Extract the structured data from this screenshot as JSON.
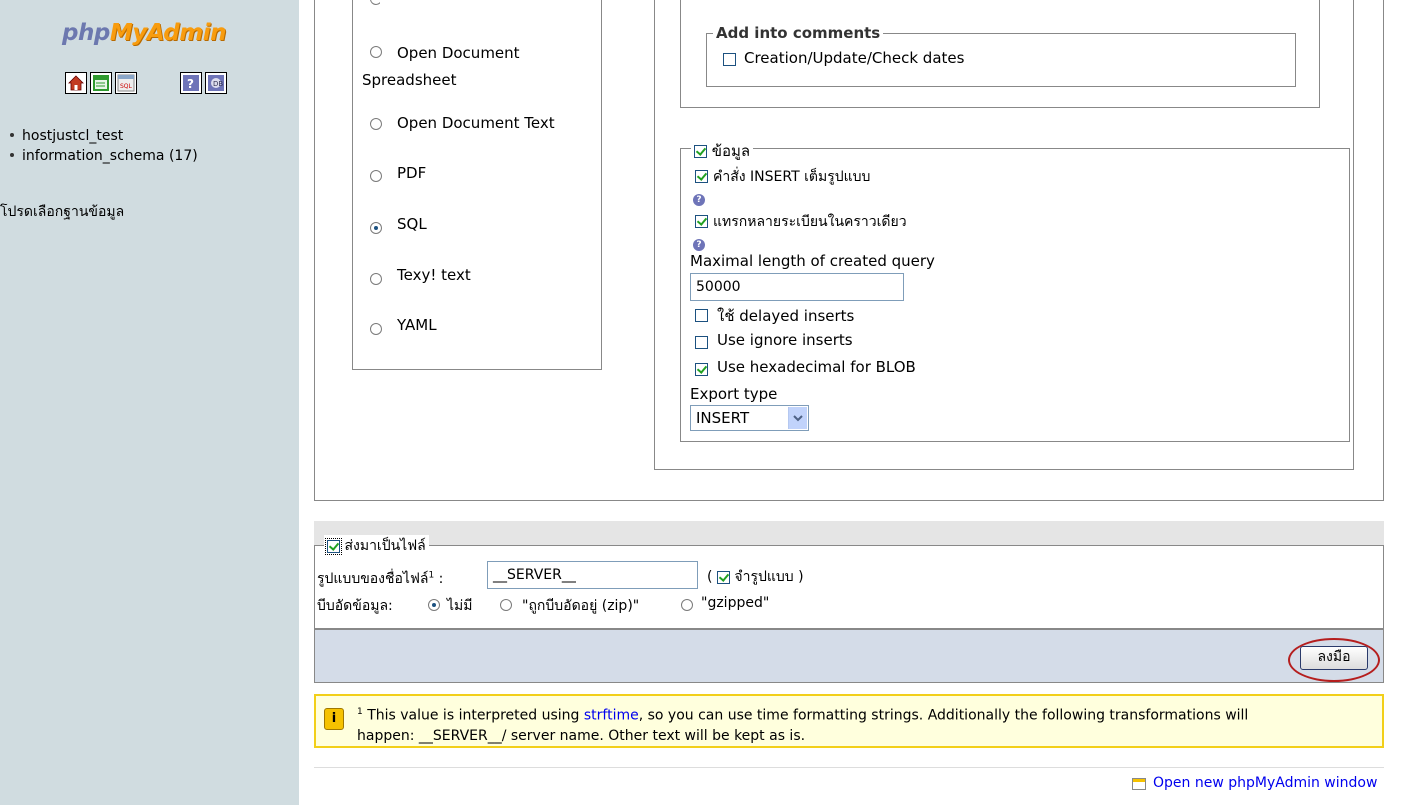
{
  "sidebar": {
    "logo_php": "php",
    "logo_myadmin": "MyAdmin",
    "nav_icons": [
      "home-icon",
      "query-window-icon",
      "sql-icon",
      "help-icon",
      "documentation-icon"
    ],
    "databases": [
      "hostjustcl_test",
      "information_schema (17)"
    ],
    "choose_db": "โปรดเลือกฐานข้อมูล"
  },
  "formats": [
    {
      "label": "Open Document Spreadsheet",
      "selected": false
    },
    {
      "label": "Open Document Text",
      "selected": false
    },
    {
      "label": "PDF",
      "selected": false
    },
    {
      "label": "SQL",
      "selected": true
    },
    {
      "label": "Texy! text",
      "selected": false
    },
    {
      "label": "YAML",
      "selected": false
    }
  ],
  "comments": {
    "legend": "Add into comments",
    "creation_dates_label": "Creation/Update/Check dates",
    "creation_dates_checked": false
  },
  "data_options": {
    "legend": "ข้อมูล",
    "complete_inserts": "คำสั่ง INSERT เต็มรูปแบบ",
    "extended_inserts": "แทรกหลายระเบียนในคราวเดียว",
    "max_query_label": "Maximal length of created query",
    "max_query_value": "50000",
    "delayed_inserts": "ใช้ delayed inserts",
    "ignore_inserts": "Use ignore inserts",
    "hex_blob": "Use hexadecimal for BLOB",
    "export_type_label": "Export type",
    "export_type_value": "INSERT"
  },
  "save_file": {
    "legend": "ส่งมาเป็นไฟล์",
    "filename_label": "รูปแบบของชื่อไฟล์",
    "footnote_mark": "1",
    "filename_value": "__SERVER__",
    "remember_open": "(",
    "remember_label": "จำรูปแบบ",
    "remember_close": ")",
    "compression_label": "บีบอัดข้อมูล:",
    "compression_none": "ไม่มี",
    "compression_zip": "\"ถูกบีบอัดอยู่ (zip)\"",
    "compression_gzip": "\"gzipped\""
  },
  "go_button": "ลงมือ",
  "notice": {
    "mark": "1",
    "text_before": "This value is interpreted using ",
    "link": "strftime",
    "text_after": ", so you can use time formatting strings. Additionally the following transformations will",
    "line2": "happen: __SERVER__/ server name. Other text will be kept as is."
  },
  "footer": {
    "open_window": "Open new phpMyAdmin window"
  }
}
